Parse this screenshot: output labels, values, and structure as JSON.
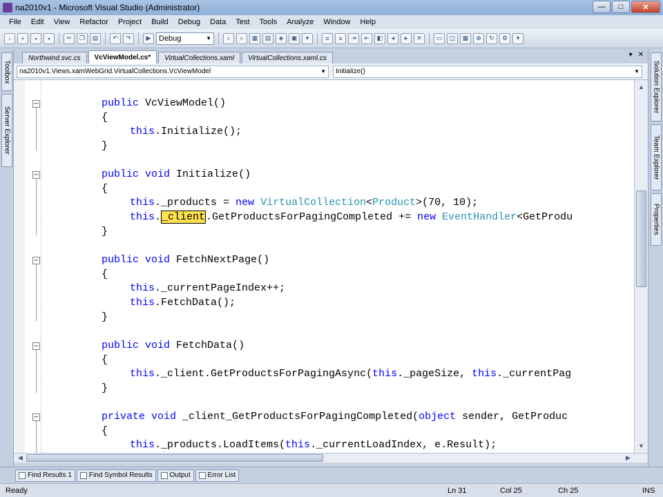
{
  "window": {
    "title": "na2010v1 - Microsoft Visual Studio (Administrator)",
    "minimize": "—",
    "maximize": "□",
    "close": "✕"
  },
  "menu": [
    "File",
    "Edit",
    "View",
    "Refactor",
    "Project",
    "Build",
    "Debug",
    "Data",
    "Test",
    "Tools",
    "Analyze",
    "Window",
    "Help"
  ],
  "toolbar": {
    "configuration": "Debug"
  },
  "left_dock": [
    "Toolbox",
    "Server Explorer"
  ],
  "right_dock": [
    "Solution Explorer",
    "Team Explorer",
    "Properties"
  ],
  "doc_tabs": [
    {
      "label": "Northwind.svc.cs"
    },
    {
      "label": "VcViewModel.cs*"
    },
    {
      "label": "VirtualCollections.xaml"
    },
    {
      "label": "VirtualCollections.xaml.cs"
    }
  ],
  "doc_controls": {
    "dropdown": "▾",
    "close": "✕"
  },
  "navigation": {
    "type_dropdown": "na2010v1.Views.xamWebGrid.VirtualCollections.VcViewModel",
    "member_dropdown": "Initialize()"
  },
  "code": {
    "l1": {
      "kw": "public",
      "rest": " VcViewModel()"
    },
    "l2": "{",
    "l3": {
      "kw": "this",
      "rest": ".Initialize();"
    },
    "l4": "}",
    "l5": {
      "kw1": "public",
      "kw2": "void",
      "rest": " Initialize()"
    },
    "l6": "{",
    "l7": {
      "kw": "this",
      "a": "._products = ",
      "kw2": "new",
      "ty1": "VirtualCollection",
      "b": "<",
      "ty2": "Product",
      "c": ">(70, 10);"
    },
    "l8": {
      "kw": "this",
      "dot": ".",
      "hl": "_client",
      "a": ".GetProductsForPagingCompleted += ",
      "kw2": "new",
      "ty": "EventHandler",
      "b": "<GetProdu"
    },
    "l9": "}",
    "l10": {
      "kw1": "public",
      "kw2": "void",
      "rest": " FetchNextPage()"
    },
    "l11": "{",
    "l12": {
      "kw": "this",
      "rest": "._currentPageIndex++;"
    },
    "l13": {
      "kw": "this",
      "rest": ".FetchData();"
    },
    "l14": "}",
    "l15": {
      "kw1": "public",
      "kw2": "void",
      "rest": " FetchData()"
    },
    "l16": "{",
    "l17": {
      "kw": "this",
      "a": "._client.GetProductsForPagingAsync(",
      "kw2": "this",
      "b": "._pageSize, ",
      "kw3": "this",
      "c": "._currentPag"
    },
    "l18": "}",
    "l19": {
      "kw1": "private",
      "kw2": "void",
      "a": " _client_GetProductsForPagingCompleted(",
      "kw3": "object",
      "b": " sender, GetProduc"
    },
    "l20": "{",
    "l21": {
      "kw": "this",
      "a": "._products.LoadItems(",
      "kw2": "this",
      "b": "._currentLoadIndex, e.Result);"
    }
  },
  "bottom_tabs": [
    "Find Results 1",
    "Find Symbol Results",
    "Output",
    "Error List"
  ],
  "status": {
    "ready": "Ready",
    "ln": "Ln 31",
    "col": "Col 25",
    "ch": "Ch 25",
    "ins": "INS"
  }
}
